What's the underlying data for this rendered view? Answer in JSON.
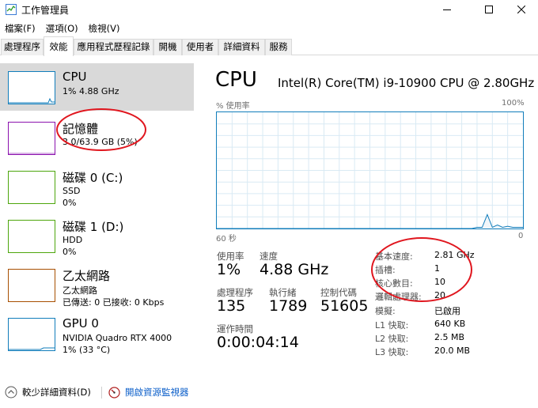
{
  "window": {
    "title": "工作管理員",
    "controls": {
      "minimize": "minimize-icon",
      "maximize": "maximize-icon",
      "close": "close-icon"
    }
  },
  "menu": {
    "items": [
      "檔案(F)",
      "選項(O)",
      "檢視(V)"
    ]
  },
  "tabs": [
    "處理程序",
    "效能",
    "應用程式歷程記錄",
    "開機",
    "使用者",
    "詳細資料",
    "服務"
  ],
  "active_tab": "效能",
  "resources": [
    {
      "name": "CPU",
      "line2": "1% 4.88 GHz",
      "line3": "",
      "color": "#117dbb"
    },
    {
      "name": "記憶體",
      "line2": "3.0/63.9 GB (5%)",
      "line3": "",
      "color": "#8b12ae"
    },
    {
      "name": "磁碟 0 (C:)",
      "line2": "SSD",
      "line3": "0%",
      "color": "#4da60c"
    },
    {
      "name": "磁碟 1 (D:)",
      "line2": "HDD",
      "line3": "0%",
      "color": "#4da60c"
    },
    {
      "name": "乙太網路",
      "line2": "乙太網路",
      "line3": "已傳送: 0 已接收: 0 Kbps",
      "color": "#a74f01"
    },
    {
      "name": "GPU 0",
      "line2": "NVIDIA Quadro RTX 4000",
      "line3": "1% (33 °C)",
      "color": "#117dbb"
    }
  ],
  "detail": {
    "title": "CPU",
    "model": "Intel(R) Core(TM) i9-10900 CPU @ 2.80GHz",
    "graph": {
      "y_label": "% 使用率",
      "y_max_label": "100%",
      "x_left_label": "60 秒",
      "x_right_label": "0",
      "usage_series": [
        0,
        0,
        0,
        0,
        0,
        0,
        0,
        0,
        0,
        0,
        0,
        0,
        0,
        0,
        0,
        0,
        0,
        0,
        0,
        0,
        0,
        0,
        0,
        0,
        0,
        0,
        0,
        0,
        0,
        0,
        0,
        0,
        0,
        0,
        0,
        0,
        0,
        0,
        0,
        0,
        0,
        0,
        0,
        0,
        0,
        0,
        0,
        0,
        0,
        0,
        0,
        1,
        1,
        12,
        1,
        3,
        1,
        2,
        1,
        1,
        1
      ]
    },
    "stats": {
      "utilization": {
        "label": "使用率",
        "value": "1%"
      },
      "speed": {
        "label": "速度",
        "value": "4.88 GHz"
      },
      "processes": {
        "label": "處理程序",
        "value": "135"
      },
      "threads": {
        "label": "執行緒",
        "value": "1789"
      },
      "handles": {
        "label": "控制代碼",
        "value": "51605"
      },
      "uptime": {
        "label": "運作時間",
        "value": "0:00:04:14"
      }
    },
    "properties": [
      {
        "label": "基本速度:",
        "value": "2.81 GHz"
      },
      {
        "label": "插槽:",
        "value": "1"
      },
      {
        "label": "核心數目:",
        "value": "10"
      },
      {
        "label": "邏輯處理器:",
        "value": "20"
      },
      {
        "label": "模擬:",
        "value": "已啟用"
      },
      {
        "label": "L1 快取:",
        "value": "640 KB"
      },
      {
        "label": "L2 快取:",
        "value": "2.5 MB"
      },
      {
        "label": "L3 快取:",
        "value": "20.0 MB"
      }
    ]
  },
  "footer": {
    "fewer_details": "較少詳細資料(D)",
    "open_resmon": "開啟資源監視器"
  },
  "colors": {
    "cpu": "#117dbb",
    "annotation": "#e0161e",
    "selected_bg": "#d9d9d9"
  }
}
